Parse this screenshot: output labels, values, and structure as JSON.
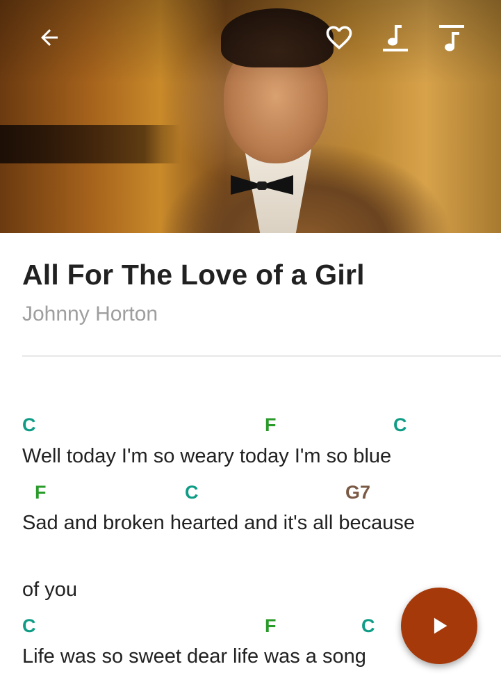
{
  "header": {
    "icons": {
      "back": "arrow-back-icon",
      "favorite": "heart-outline-icon",
      "chords_toggle": "music-note-underline-icon",
      "lyrics_toggle": "music-note-overline-icon"
    }
  },
  "song": {
    "title": "All For The Love of a Girl",
    "artist": "Johnny Horton"
  },
  "sheet": {
    "chord_colors": {
      "C": "#0f9c86",
      "F": "#2a9a2a",
      "G7": "#7a5a44"
    },
    "lines": [
      {
        "chords": [
          "C",
          "F",
          "C"
        ],
        "lyric": "Well today I'm so weary today I'm so blue"
      },
      {
        "chords": [
          "F",
          "C",
          "G7"
        ],
        "lyric": "Sad and broken hearted and it's all because"
      },
      {
        "chords": [],
        "lyric": "of you"
      },
      {
        "chords": [
          "C",
          "F",
          "C"
        ],
        "lyric": "Life was so sweet dear life was a song"
      }
    ]
  },
  "fab": {
    "icon": "play-icon",
    "color": "#a6390a"
  }
}
